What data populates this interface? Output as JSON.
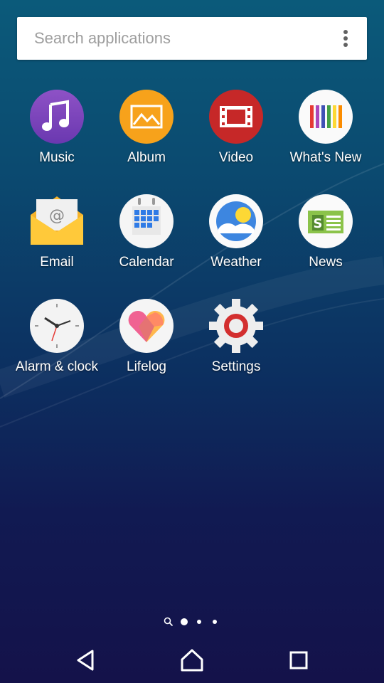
{
  "search": {
    "placeholder": "Search applications",
    "menu_icon": "more-vert-icon"
  },
  "apps": [
    {
      "label": "Music",
      "icon": "music-note-icon"
    },
    {
      "label": "Album",
      "icon": "album-icon"
    },
    {
      "label": "Video",
      "icon": "film-icon"
    },
    {
      "label": "What's New",
      "icon": "whats-new-icon"
    },
    {
      "label": "Email",
      "icon": "email-icon"
    },
    {
      "label": "Calendar",
      "icon": "calendar-icon"
    },
    {
      "label": "Weather",
      "icon": "weather-icon"
    },
    {
      "label": "News",
      "icon": "news-icon"
    },
    {
      "label": "Alarm & clock",
      "icon": "clock-icon"
    },
    {
      "label": "Lifelog",
      "icon": "lifelog-heart-icon"
    },
    {
      "label": "Settings",
      "icon": "settings-gear-icon"
    }
  ],
  "pager": {
    "pages": 3,
    "active_page": 1,
    "search_icon": "search-icon"
  },
  "navbar": {
    "back": "back-icon",
    "home": "home-icon",
    "recents": "recents-icon"
  }
}
